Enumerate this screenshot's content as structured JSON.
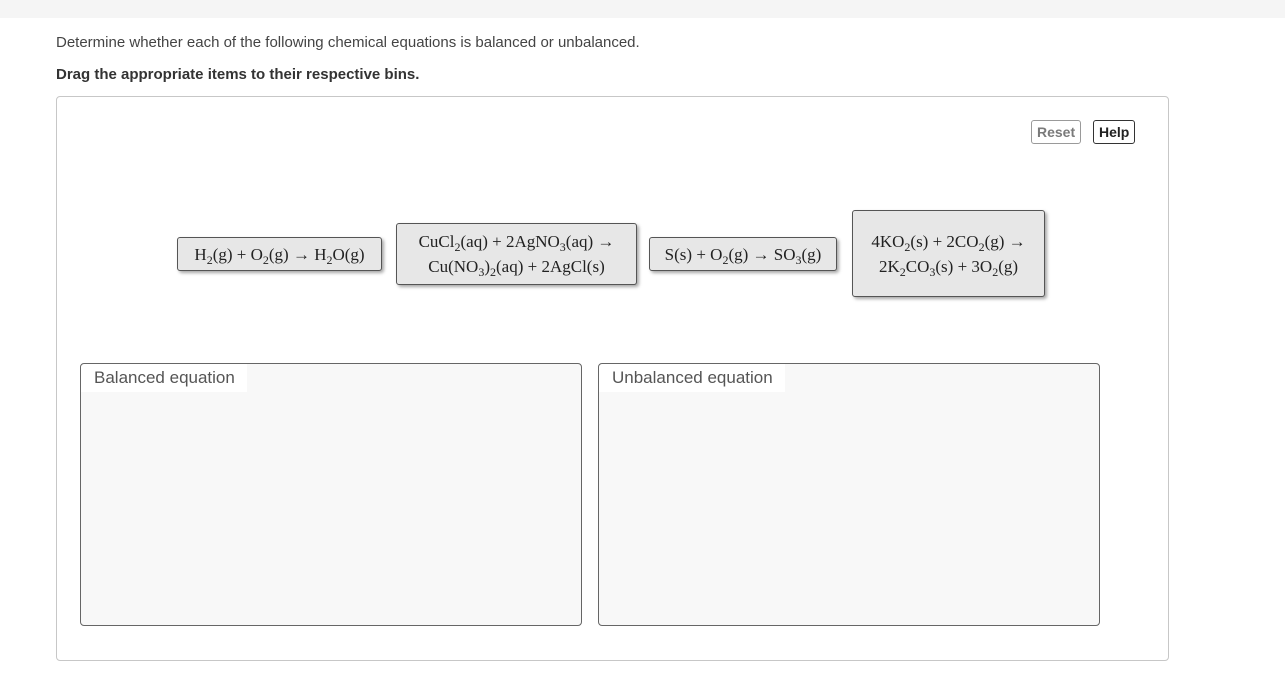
{
  "instructions": "Determine whether each of the following chemical equations is balanced or unbalanced.",
  "drag_note": "Drag the appropriate items to their respective bins.",
  "controls": {
    "reset_label": "Reset",
    "help_label": "Help"
  },
  "items": [
    {
      "lines": [
        [
          [
            "H",
            "2",
            "(g) + O",
            "2",
            "(g) → H",
            "2",
            "O(g)"
          ]
        ]
      ]
    },
    {
      "lines": [
        [
          "CuCl",
          "2",
          "(aq) + 2AgNO",
          "3",
          "(aq) →"
        ],
        [
          "Cu(NO",
          "3",
          ")",
          "2",
          "(aq) + 2AgCl(s)"
        ]
      ]
    },
    {
      "lines": [
        [
          "S(s) + O",
          "2",
          "(g) → SO",
          "3",
          "(g)"
        ]
      ]
    },
    {
      "lines": [
        [
          "4KO",
          "2",
          "(s) + 2CO",
          "2",
          "(g) →"
        ],
        [
          "2K",
          "2",
          "CO",
          "3",
          "(s) + 3O",
          "2",
          "(g)"
        ]
      ]
    }
  ],
  "bins": {
    "balanced_label": "Balanced equation",
    "unbalanced_label": "Unbalanced equation"
  },
  "colors": {
    "chip_bg": "#e7e7e7",
    "bin_bg": "#f8f8f8",
    "panel_border": "#c7c7c7"
  }
}
